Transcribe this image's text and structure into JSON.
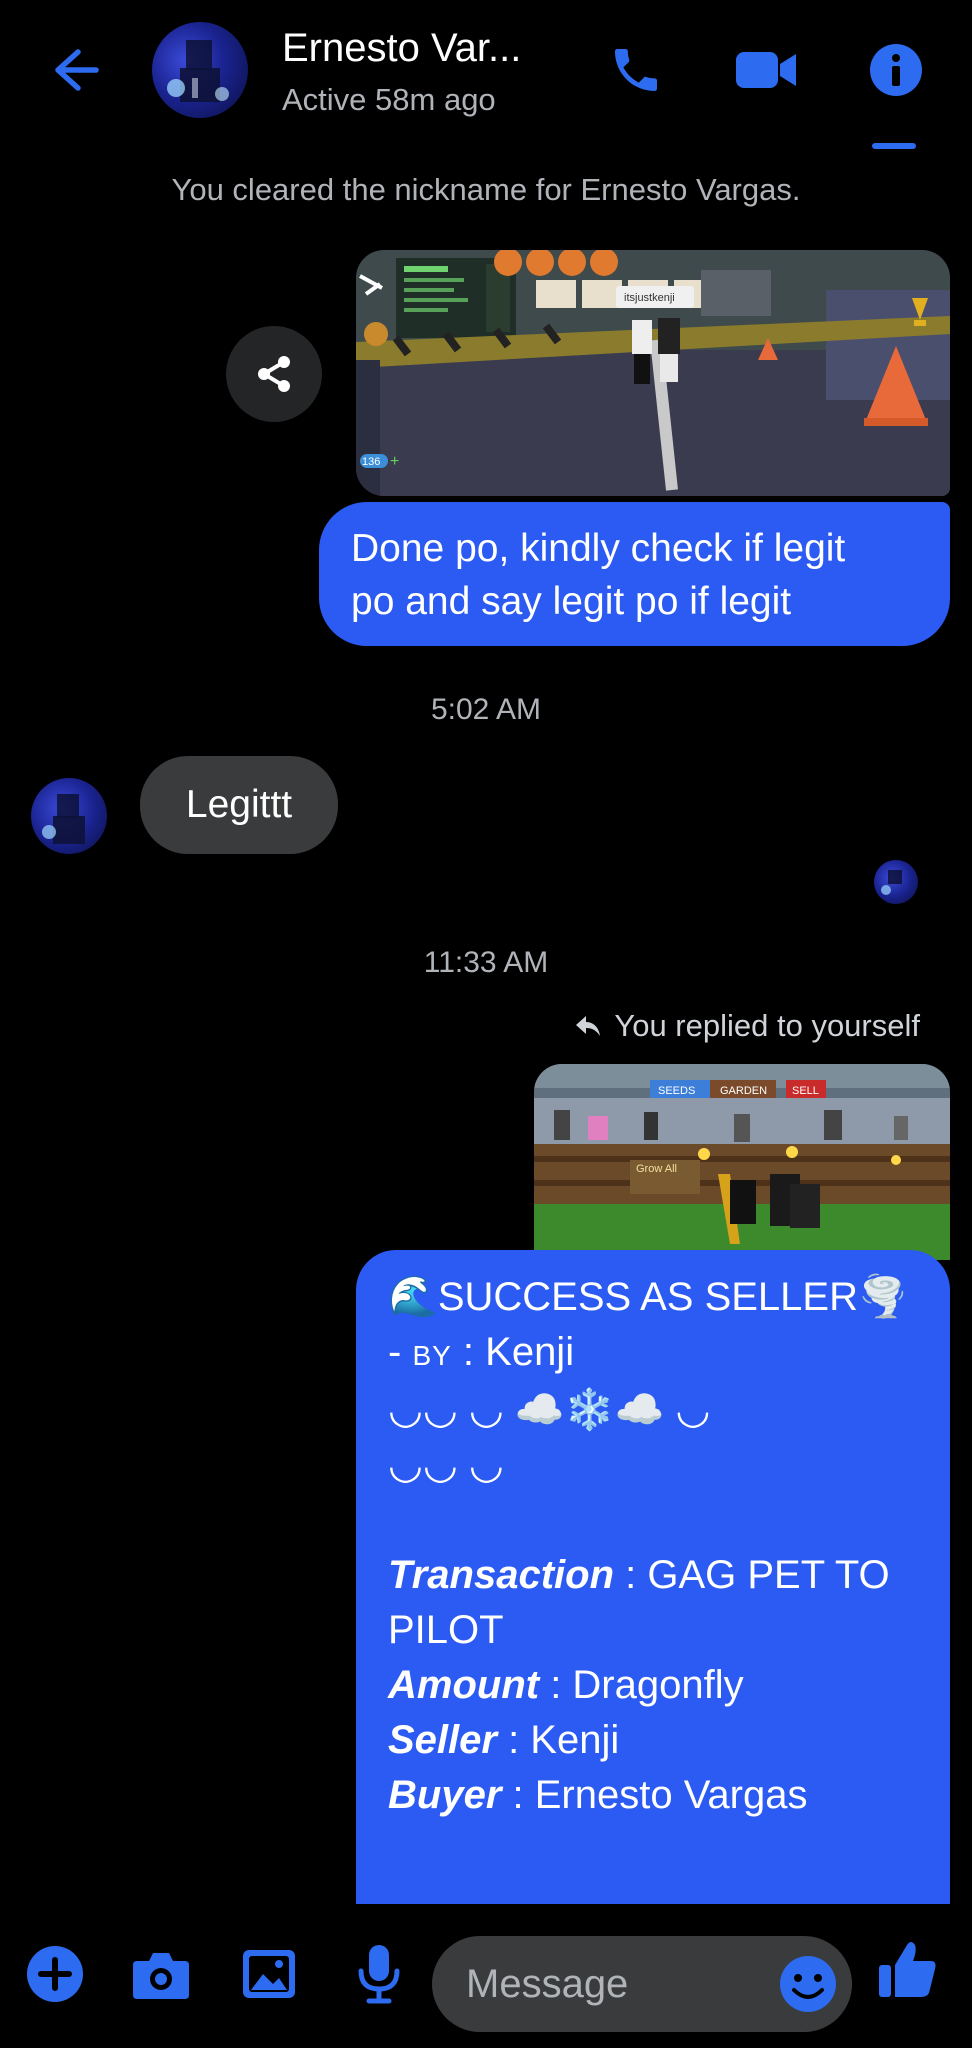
{
  "header": {
    "contact_name": "Ernesto Var...",
    "status": "Active 58m ago",
    "accent_color": "#2d6bf0"
  },
  "thread": {
    "system_note": "You cleared the nickname for Ernesto Vargas.",
    "outgoing_message_1": {
      "line1": "Done po, kindly check if legit",
      "line2": "po and say legit po if legit"
    },
    "game_screenshot_1": {
      "player_tag": "itsjustkenji",
      "gems_count": "136"
    },
    "timestamp_1": "5:02 AM",
    "incoming_message_1": "Legittt",
    "timestamp_2": "11:33 AM",
    "reply_note": "You replied to yourself",
    "game_screenshot_2": {
      "tab_seeds": "SEEDS",
      "tab_garden": "GARDEN",
      "tab_sell": "SELL",
      "sign_text": "Grow All"
    },
    "success_message": {
      "title_emoji_left": "🌊",
      "title": "SUCCESS AS SELLER",
      "title_emoji_right": "🌪️",
      "by_prefix": "- ",
      "by_label": "BY",
      "by_value": " : Kenji",
      "deco_line1": "◡◡ ◡ ☁️❄️☁️ ◡",
      "deco_line2": "◡◡ ◡",
      "transaction_label": "Transaction",
      "transaction_value_line1": " : GAG PET TO",
      "transaction_value_line2": "PILOT",
      "amount_label": "Amount",
      "amount_value": " : Dragonfly",
      "seller_label": "Seller",
      "seller_value": " : Kenji",
      "buyer_label": "Buyer",
      "buyer_value": " : Ernesto Vargas"
    }
  },
  "composer": {
    "placeholder": "Message"
  },
  "icons": [
    "back-arrow-icon",
    "phone-icon",
    "video-camera-icon",
    "info-icon",
    "share-icon",
    "reply-arrow-icon",
    "plus-icon",
    "camera-icon",
    "gallery-icon",
    "microphone-icon",
    "emoji-icon",
    "thumbs-up-icon"
  ]
}
